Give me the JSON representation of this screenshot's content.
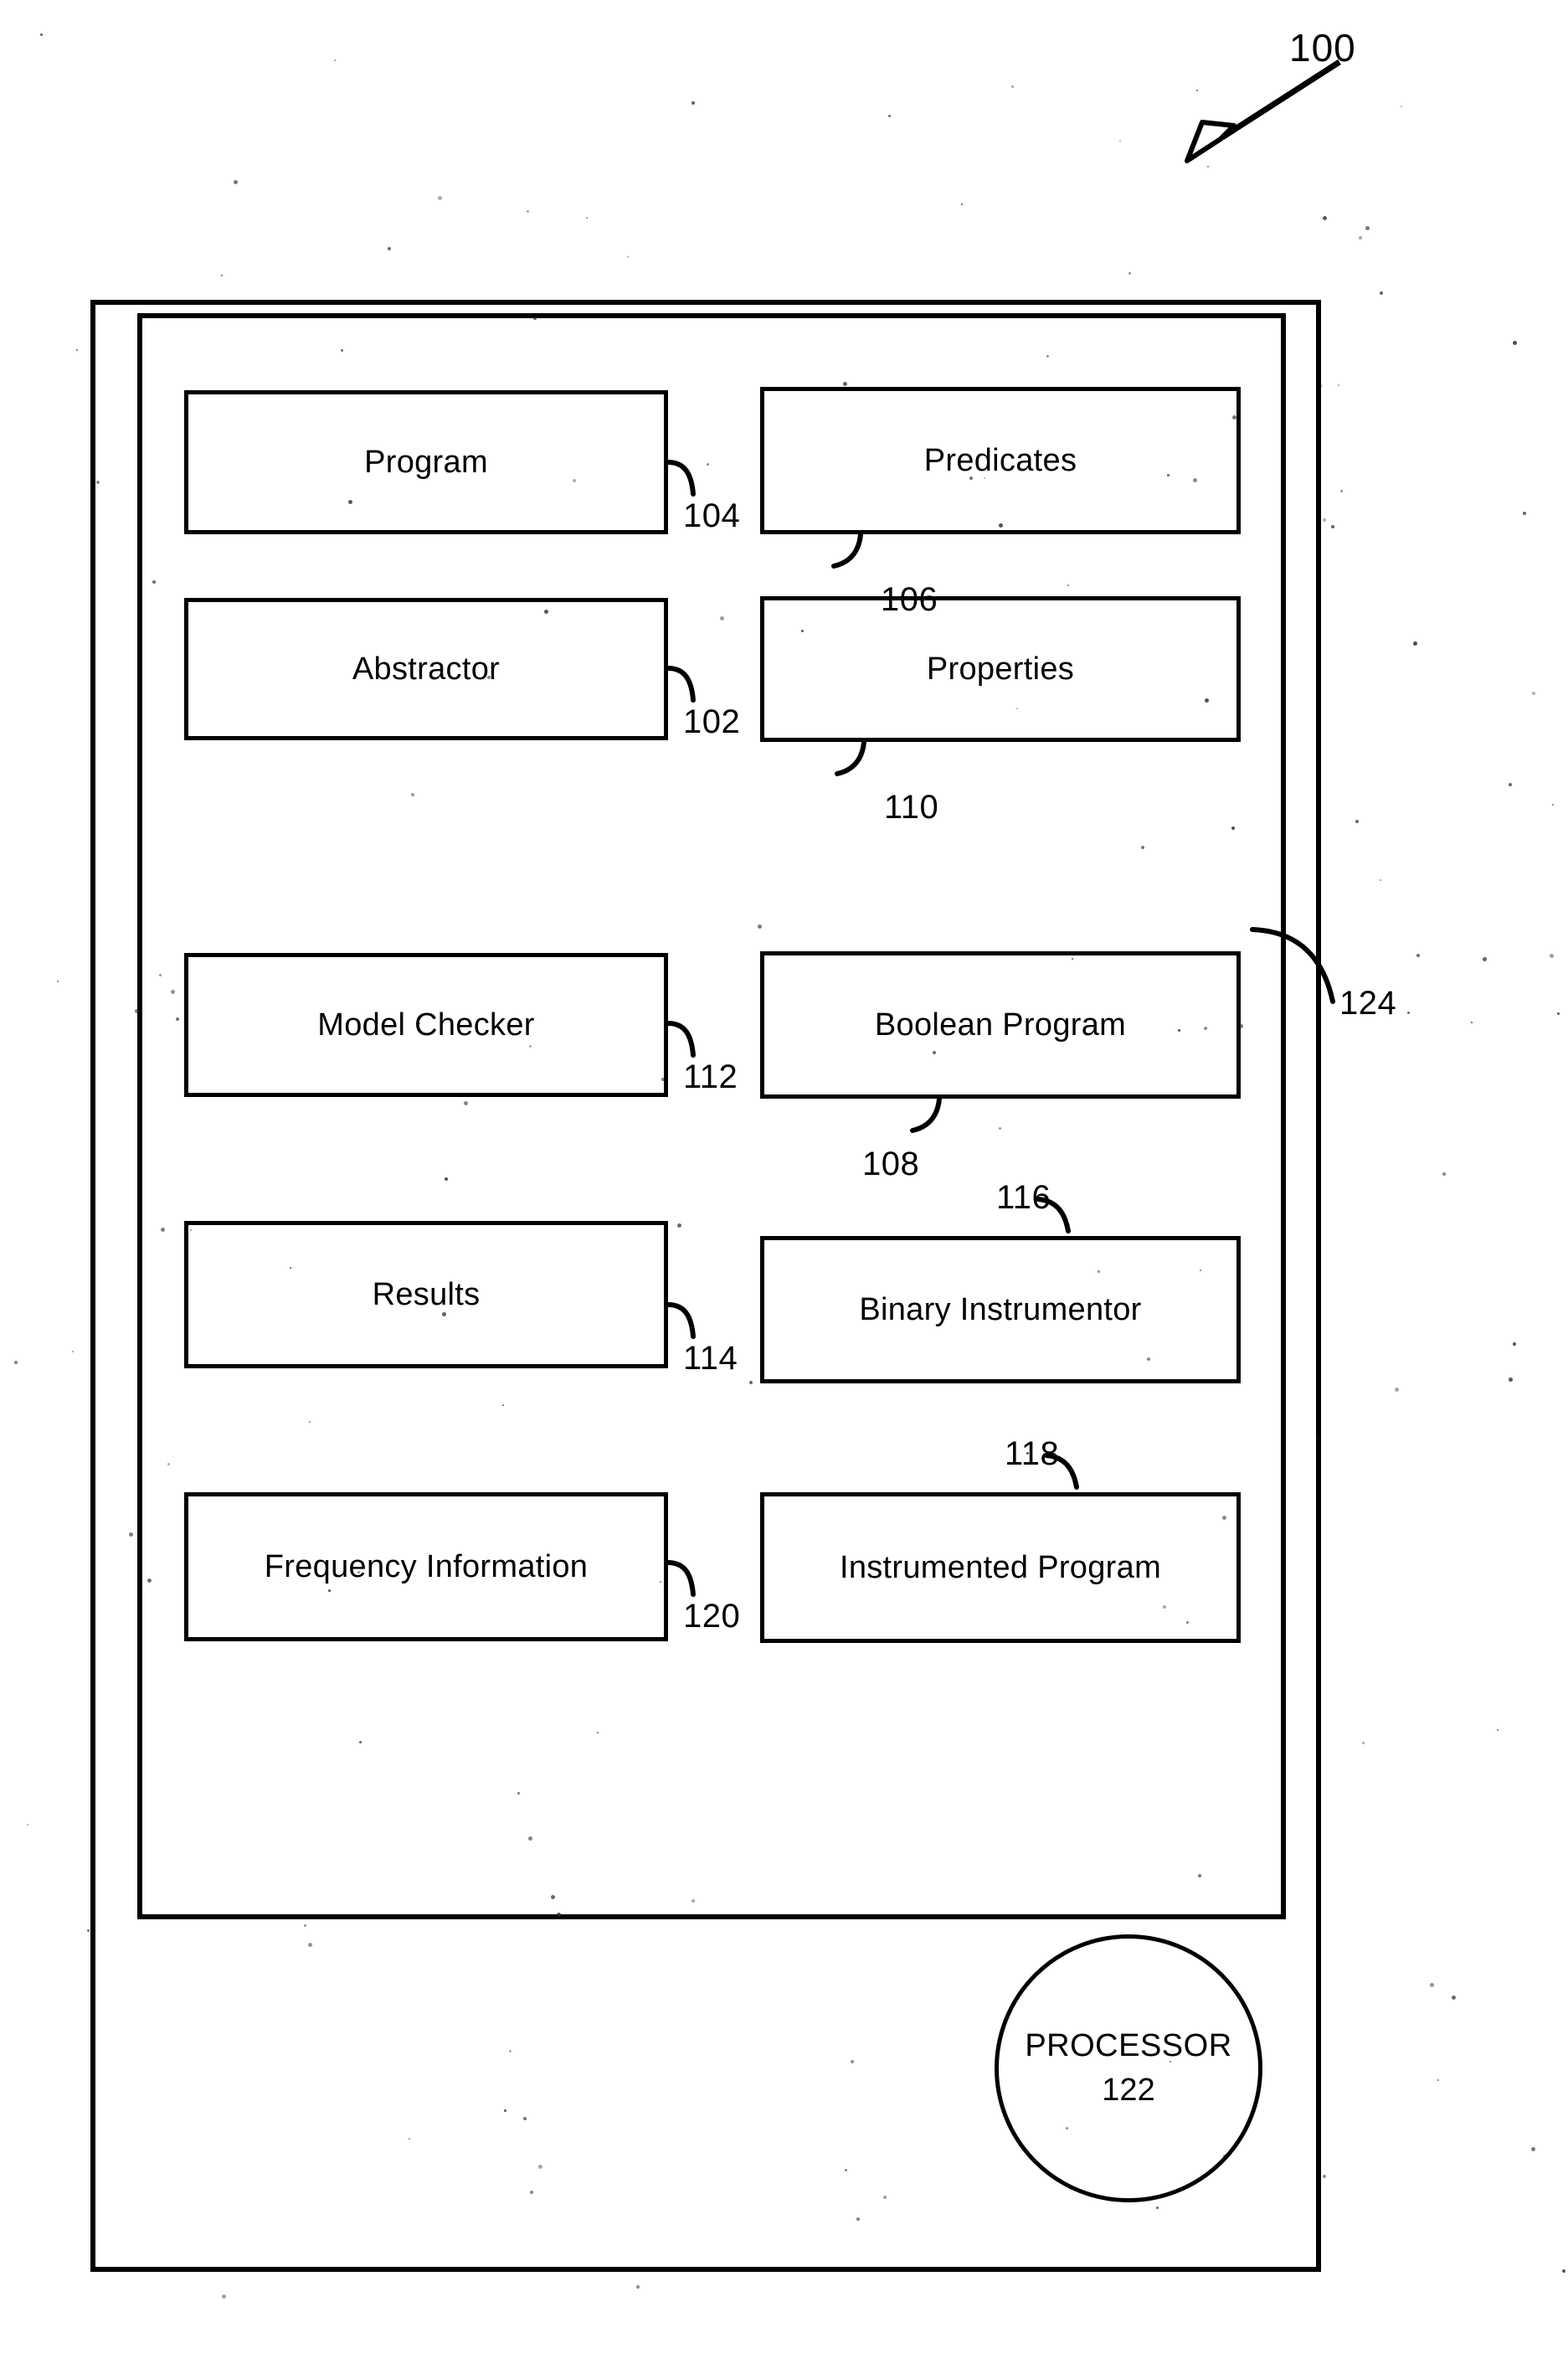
{
  "figure": {
    "reference_numeral": "100",
    "arrow_icon": "callout-arrow-icon"
  },
  "system": {
    "outer_frame_name": "system-boundary",
    "inner_frame_name": "memory-boundary",
    "inner_frame_numeral": "124"
  },
  "components": [
    {
      "label": "Program",
      "numeral": "104",
      "numeral_side": "right"
    },
    {
      "label": "Predicates",
      "numeral": "106",
      "numeral_side": "bottom-left"
    },
    {
      "label": "Abstractor",
      "numeral": "102",
      "numeral_side": "right"
    },
    {
      "label": "Properties",
      "numeral": "110",
      "numeral_side": "bottom-left"
    },
    {
      "label": "Model Checker",
      "numeral": "112",
      "numeral_side": "right"
    },
    {
      "label": "Boolean Program",
      "numeral": "108",
      "numeral_side": "bottom-left"
    },
    {
      "label": "Results",
      "numeral": "114",
      "numeral_side": "right"
    },
    {
      "label": "Binary Instrumentor",
      "numeral": "116",
      "numeral_side": "top-right"
    },
    {
      "label": "Frequency Information",
      "numeral": "120",
      "numeral_side": "right"
    },
    {
      "label": "Instrumented Program",
      "numeral": "118",
      "numeral_side": "top-right"
    }
  ],
  "processor": {
    "label": "PROCESSOR",
    "numeral": "122"
  },
  "colors": {
    "ink": "#000000",
    "paper": "#ffffff"
  }
}
